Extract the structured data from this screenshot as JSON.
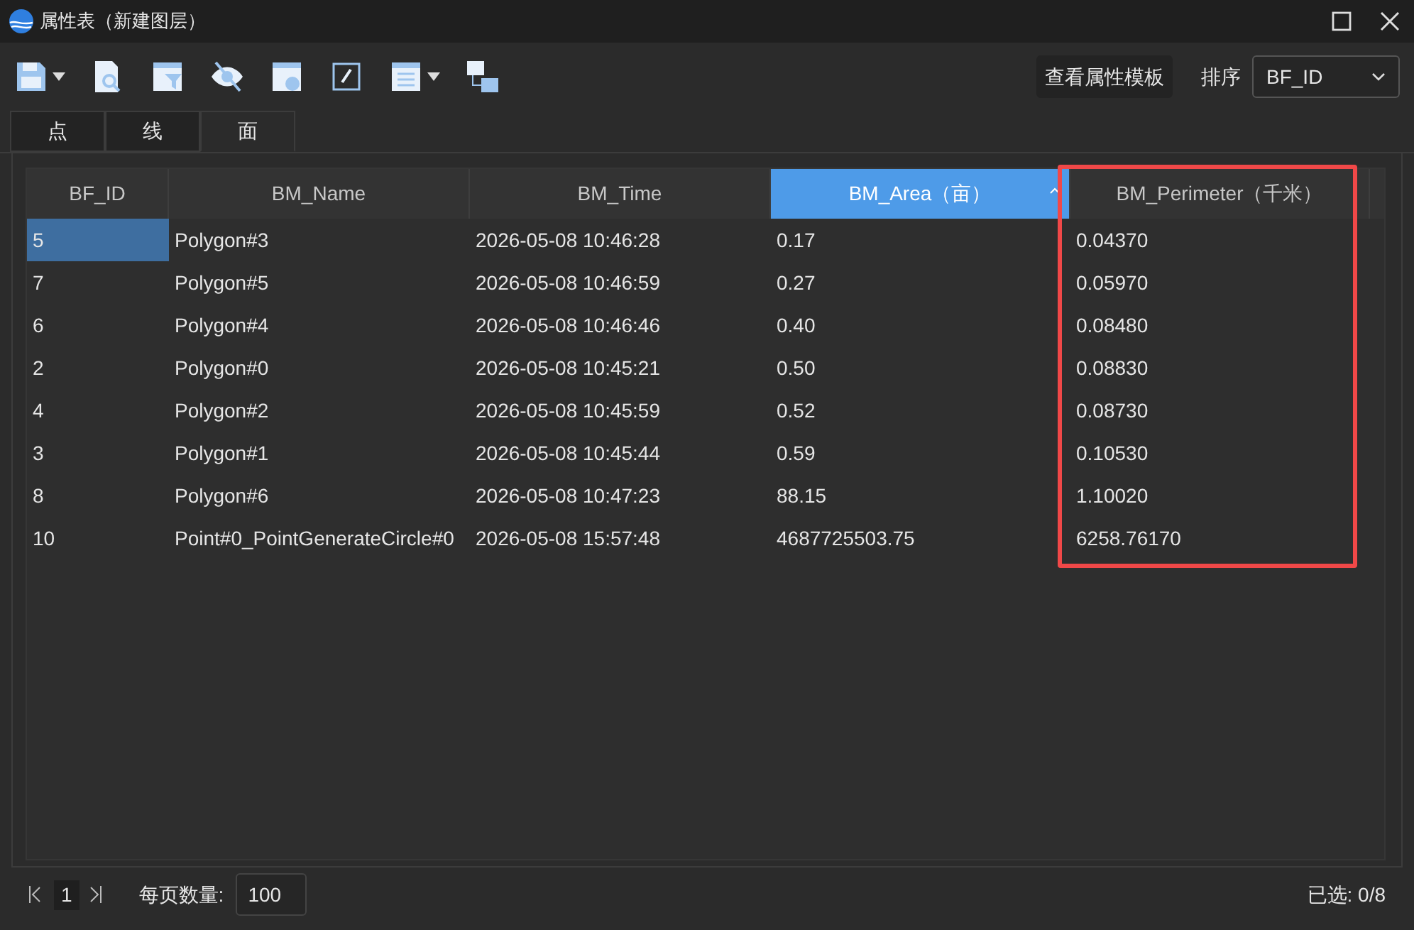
{
  "window": {
    "title": "属性表（新建图层）"
  },
  "toolbar": {
    "template_button": "查看属性模板",
    "sort_label": "排序",
    "sort_value": "BF_ID"
  },
  "tabs": [
    {
      "label": "点",
      "selected": false
    },
    {
      "label": "线",
      "selected": false
    },
    {
      "label": "面",
      "selected": true
    }
  ],
  "table": {
    "columns": [
      {
        "label": "BF_ID",
        "sorted": false,
        "highlighted": false
      },
      {
        "label": "BM_Name",
        "sorted": false,
        "highlighted": false
      },
      {
        "label": "BM_Time",
        "sorted": false,
        "highlighted": false
      },
      {
        "label": "BM_Area（亩）",
        "sorted": true,
        "highlighted": false
      },
      {
        "label": "BM_Perimeter（千米）",
        "sorted": false,
        "highlighted": true
      }
    ],
    "rows": [
      {
        "selected": true,
        "cells": [
          "5",
          "Polygon#3",
          "2026-05-08 10:46:28",
          "0.17",
          "0.04370"
        ]
      },
      {
        "selected": false,
        "cells": [
          "7",
          "Polygon#5",
          "2026-05-08 10:46:59",
          "0.27",
          "0.05970"
        ]
      },
      {
        "selected": false,
        "cells": [
          "6",
          "Polygon#4",
          "2026-05-08 10:46:46",
          "0.40",
          "0.08480"
        ]
      },
      {
        "selected": false,
        "cells": [
          "2",
          "Polygon#0",
          "2026-05-08 10:45:21",
          "0.50",
          "0.08830"
        ]
      },
      {
        "selected": false,
        "cells": [
          "4",
          "Polygon#2",
          "2026-05-08 10:45:59",
          "0.52",
          "0.08730"
        ]
      },
      {
        "selected": false,
        "cells": [
          "3",
          "Polygon#1",
          "2026-05-08 10:45:44",
          "0.59",
          "0.10530"
        ]
      },
      {
        "selected": false,
        "cells": [
          "8",
          "Polygon#6",
          "2026-05-08 10:47:23",
          "88.15",
          "1.10020"
        ]
      },
      {
        "selected": false,
        "cells": [
          "10",
          "Point#0_PointGenerateCircle#0",
          "2026-05-08 15:57:48",
          "4687725503.75",
          "6258.76170"
        ]
      }
    ]
  },
  "footer": {
    "page": "1",
    "page_size_label": "每页数量:",
    "page_size": "100",
    "selected_count": "已选: 0/8"
  }
}
